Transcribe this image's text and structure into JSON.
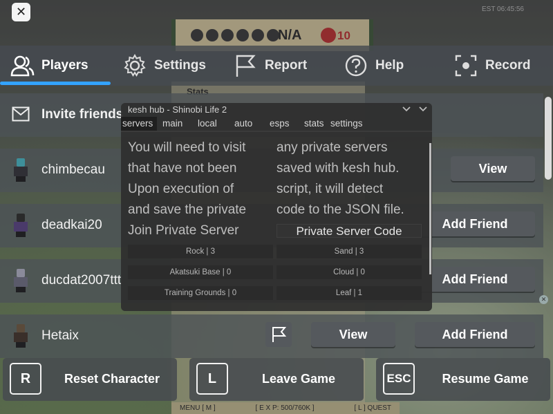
{
  "game": {
    "timer": "EST 06:45:56",
    "currency_label": "N/A",
    "coins": "10",
    "stats_label": "Stats",
    "hud": [
      "MENU [ M ]",
      "[ E X P: 500/760K ]",
      "[ L ] QUEST"
    ]
  },
  "close_button": {
    "label": "✕"
  },
  "tabs": [
    {
      "label": "Players",
      "icon": "players-icon"
    },
    {
      "label": "Settings",
      "icon": "gear-icon"
    },
    {
      "label": "Report",
      "icon": "flag-icon"
    },
    {
      "label": "Help",
      "icon": "help-icon"
    },
    {
      "label": "Record",
      "icon": "record-icon"
    }
  ],
  "invite": {
    "label": "Invite friends"
  },
  "players": [
    {
      "name": "chimbecau",
      "buttons": [
        "View"
      ]
    },
    {
      "name": "deadkai20",
      "buttons": [
        "Add Friend"
      ]
    },
    {
      "name": "ducdat2007ttt",
      "buttons": [
        "Add Friend"
      ]
    },
    {
      "name": "Hetaix",
      "buttons": [
        "View",
        "Add Friend"
      ]
    }
  ],
  "actions": [
    {
      "key": "R",
      "label": "Reset Character"
    },
    {
      "key": "L",
      "label": "Leave Game"
    },
    {
      "key": "ESC",
      "label": "Resume Game"
    }
  ],
  "hub": {
    "title": "kesh hub - Shinobi Life 2",
    "tabs": [
      "servers",
      "main",
      "local",
      "auto",
      "esps",
      "stats",
      "settings"
    ],
    "active_tab": "servers",
    "left_lines": [
      "You will need to visit",
      "that have not been",
      "Upon execution of",
      "and save the private",
      "Join Private Server"
    ],
    "right_lines": [
      "any private servers",
      "saved with kesh hub.",
      "script, it will detect",
      "code to the JSON file."
    ],
    "code_input": "Private Server Code",
    "servers": [
      [
        "Rock | 3",
        "Sand | 3"
      ],
      [
        "Akatsuki Base | 0",
        "Cloud | 0"
      ],
      [
        "Training Grounds | 0",
        "Leaf | 1"
      ]
    ]
  }
}
